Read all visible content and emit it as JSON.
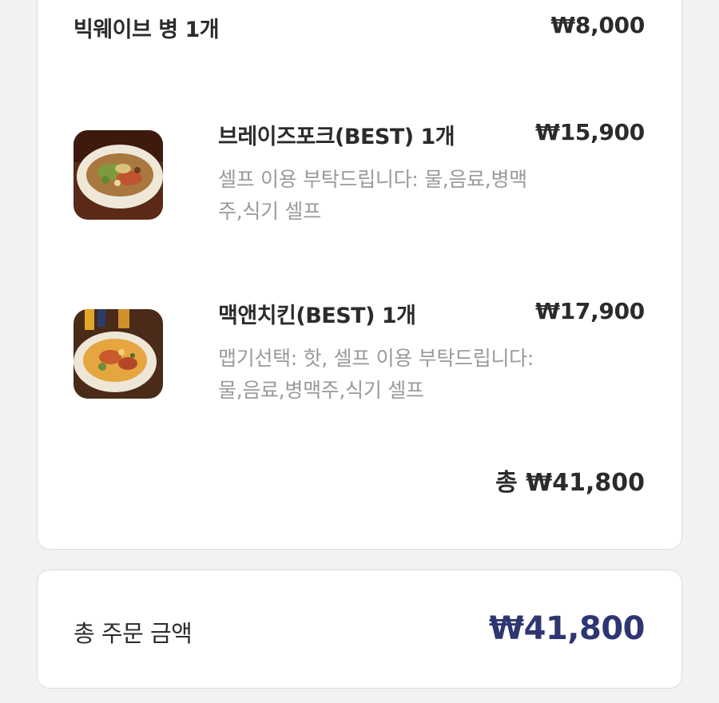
{
  "order": {
    "items": [
      {
        "name": "빅웨이브 병 1개",
        "price": "₩8,000",
        "options": ""
      },
      {
        "name": "브레이즈포크(BEST) 1개",
        "price": "₩15,900",
        "options_line1": "셀프 이용 부탁드립니다: 물,음료,병맥",
        "options_line2": "주,식기 셀프"
      },
      {
        "name": "맥앤치킨(BEST) 1개",
        "price": "₩17,900",
        "options_line1": "맵기선택: 핫, 셀프 이용 부탁드립니다:",
        "options_line2": "물,음료,병맥주,식기 셀프"
      }
    ],
    "subtotal": "총 ₩41,800"
  },
  "summary": {
    "label": "총 주문 금액",
    "value": "₩41,800"
  },
  "colors": {
    "accent_total": "#2e3672",
    "option_text": "#9a9a9a"
  }
}
